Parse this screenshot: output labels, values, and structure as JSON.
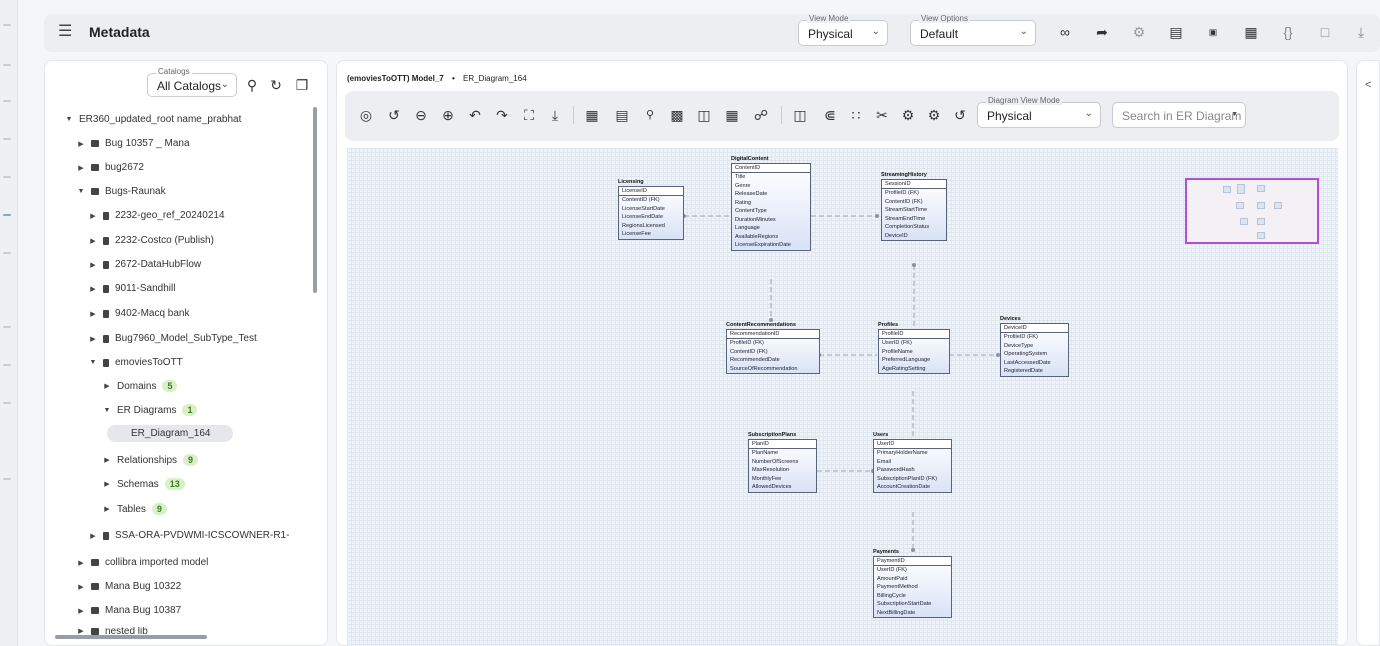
{
  "header": {
    "title": "Metadata",
    "view_mode": {
      "label": "View Mode",
      "value": "Physical"
    },
    "view_options": {
      "label": "View Options",
      "value": "Default"
    },
    "icons": [
      "link-icon",
      "share-icon",
      "hierarchy-icon",
      "comment-icon",
      "csv-icon",
      "excel-icon",
      "json-icon",
      "report-icon",
      "download-icon"
    ]
  },
  "tree": {
    "catalogs": {
      "label": "Catalogs",
      "value": "All Catalogs"
    },
    "items": [
      {
        "label": "ER360_updated_root name_prabhat",
        "level": 0,
        "type": "root",
        "expanded": true
      },
      {
        "label": "Bug 10357 _ Mana",
        "level": 1,
        "type": "folder"
      },
      {
        "label": "bug2672",
        "level": 1,
        "type": "folder"
      },
      {
        "label": "Bugs-Raunak",
        "level": 1,
        "type": "folder",
        "expanded": true
      },
      {
        "label": "2232-geo_ref_20240214",
        "level": 2,
        "type": "file"
      },
      {
        "label": "2232-Costco (Publish)",
        "level": 2,
        "type": "file"
      },
      {
        "label": "2672-DataHubFlow",
        "level": 2,
        "type": "file"
      },
      {
        "label": "9011-Sandhill",
        "level": 2,
        "type": "file"
      },
      {
        "label": "9402-Macq bank",
        "level": 2,
        "type": "file"
      },
      {
        "label": "Bug7960_Model_SubType_Test",
        "level": 2,
        "type": "file"
      },
      {
        "label": "emoviesToOTT",
        "level": 2,
        "type": "file",
        "expanded": true
      },
      {
        "label": "Domains",
        "level": 3,
        "type": "group",
        "badge": "5"
      },
      {
        "label": "ER Diagrams",
        "level": 3,
        "type": "group",
        "badge": "1",
        "expanded": true
      },
      {
        "label": "ER_Diagram_164",
        "level": 4,
        "type": "selected"
      },
      {
        "label": "Relationships",
        "level": 3,
        "type": "group",
        "badge": "9"
      },
      {
        "label": "Schemas",
        "level": 3,
        "type": "group",
        "badge": "13"
      },
      {
        "label": "Tables",
        "level": 3,
        "type": "group",
        "badge": "9"
      },
      {
        "label": "SSA-ORA-PVDWMI-ICSCOWNER-R1-",
        "level": 2,
        "type": "file"
      },
      {
        "label": "collibra imported model",
        "level": 1,
        "type": "folder"
      },
      {
        "label": "Mana Bug 10322",
        "level": 1,
        "type": "folder"
      },
      {
        "label": "Mana Bug 10387",
        "level": 1,
        "type": "folder"
      },
      {
        "label": "nested lib",
        "level": 1,
        "type": "folder"
      }
    ]
  },
  "main": {
    "breadcrumb_model": "(emoviesToOTT) Model_7",
    "breadcrumb_sep": "•",
    "breadcrumb_diagram": "ER_Diagram_164",
    "diagram_view_mode": {
      "label": "Diagram View Mode",
      "value": "Physical"
    },
    "search": {
      "placeholder": "Search in ER Diagram"
    }
  },
  "entities": {
    "licensing": {
      "name": "Licensing",
      "pk": "LicenseID",
      "attrs": [
        "ContentID (FK)",
        "LicenseStartDate",
        "LicenseEndDate",
        "RegionsLicensed",
        "LicenseFee"
      ]
    },
    "digital": {
      "name": "DigitalContent",
      "pk": "ContentID",
      "attrs": [
        "Title",
        "Genre",
        "ReleaseDate",
        "Rating",
        "ContentType",
        "DurationMinutes",
        "Language",
        "AvailableRegions",
        "LicenseExpirationDate"
      ]
    },
    "streaming": {
      "name": "StreamingHistory",
      "pk": "SessionID",
      "attrs": [
        "ProfileID (FK)",
        "ContentID (FK)",
        "StreamStartTime",
        "StreamEndTime",
        "CompletionStatus",
        "DeviceID"
      ]
    },
    "recs": {
      "name": "ContentRecommendations",
      "pk": "RecommendationID",
      "attrs": [
        "ProfileID (FK)",
        "ContentID (FK)",
        "RecommendedDate",
        "SourceOfRecommendation"
      ]
    },
    "profiles": {
      "name": "Profiles",
      "pk": "ProfileID",
      "attrs": [
        "UserID (FK)",
        "ProfileName",
        "PreferredLanguage",
        "AgeRatingSetting"
      ]
    },
    "devices": {
      "name": "Devices",
      "pk": "DeviceID",
      "attrs": [
        "ProfileID (FK)",
        "DeviceType",
        "OperatingSystem",
        "LastAccessedDate",
        "RegisteredDate"
      ]
    },
    "plans": {
      "name": "SubscriptionPlans",
      "pk": "PlanID",
      "attrs": [
        "PlanName",
        "NumberOfScreens",
        "MaxResolution",
        "MonthlyFee",
        "AllowedDevices"
      ]
    },
    "users": {
      "name": "Users",
      "pk": "UserID",
      "attrs": [
        "PrimaryHolderName",
        "Email",
        "PasswordHash",
        "SubscriptionPlanID (FK)",
        "AccountCreationDate"
      ]
    },
    "payments": {
      "name": "Payments",
      "pk": "PaymentID",
      "attrs": [
        "UserID (FK)",
        "AmountPaid",
        "PaymentMethod",
        "BillingCycle",
        "SubscriptionStartDate",
        "NextBillingDate"
      ]
    }
  }
}
